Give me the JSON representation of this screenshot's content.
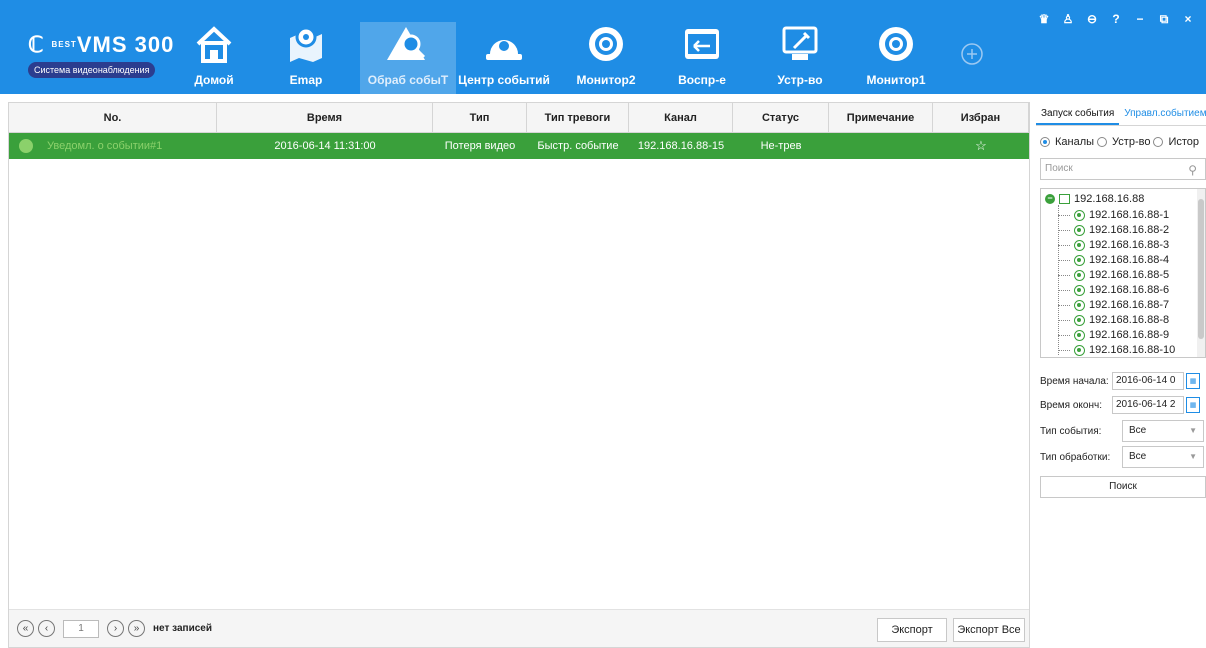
{
  "app": {
    "logo_text": "VMS 300",
    "logo_prefix": "BEST",
    "tagline": "Система видеонаблюдения"
  },
  "nav": [
    {
      "label": "Домой",
      "icon": "home-icon"
    },
    {
      "label": "Emap",
      "icon": "map-pin-icon"
    },
    {
      "label": "Обраб собыТ",
      "icon": "event-search-icon",
      "active": true
    },
    {
      "label": "Центр событий",
      "icon": "dome-camera-icon"
    },
    {
      "label": "Монитор2",
      "icon": "monitor-lens-icon"
    },
    {
      "label": "Воспр-е",
      "icon": "playback-icon"
    },
    {
      "label": "Устр-во",
      "icon": "device-config-icon"
    },
    {
      "label": "Монитор1",
      "icon": "monitor-lens-icon"
    }
  ],
  "window_controls": [
    "user-icon",
    "person-icon",
    "lock-icon",
    "?",
    "−",
    "restore-icon",
    "×"
  ],
  "table": {
    "columns": [
      "No.",
      "Время",
      "Тип",
      "Тип тревоги",
      "Канал",
      "Статус",
      "Примечание",
      "Избран"
    ],
    "rows": [
      [
        "Уведомл. о событии#1",
        "2016-06-14 11:31:00",
        "Потеря видео",
        "Быстр. событие",
        "192.168.16.88-15",
        "Не-трев",
        "",
        "☆"
      ]
    ]
  },
  "pager": {
    "page": "1",
    "status": "нет записей",
    "export": "Экспорт",
    "export_all": "Экспорт Все"
  },
  "panel": {
    "tabs": [
      "Запуск события",
      "Управл.событием"
    ],
    "radios": [
      "Каналы",
      "Устр-во",
      "Истор"
    ],
    "search_placeholder": "Поиск",
    "tree_root": "192.168.16.88",
    "tree_items": [
      "192.168.16.88-1",
      "192.168.16.88-2",
      "192.168.16.88-3",
      "192.168.16.88-4",
      "192.168.16.88-5",
      "192.168.16.88-6",
      "192.168.16.88-7",
      "192.168.16.88-8",
      "192.168.16.88-9",
      "192.168.16.88-10"
    ],
    "start_label": "Время начала:",
    "start_value": "2016-06-14 0",
    "end_label": "Время оконч:",
    "end_value": "2016-06-14 2",
    "event_type_label": "Тип события:",
    "event_type_value": "Все",
    "process_type_label": "Тип обработки:",
    "process_type_value": "Все",
    "find_button": "Поиск"
  }
}
